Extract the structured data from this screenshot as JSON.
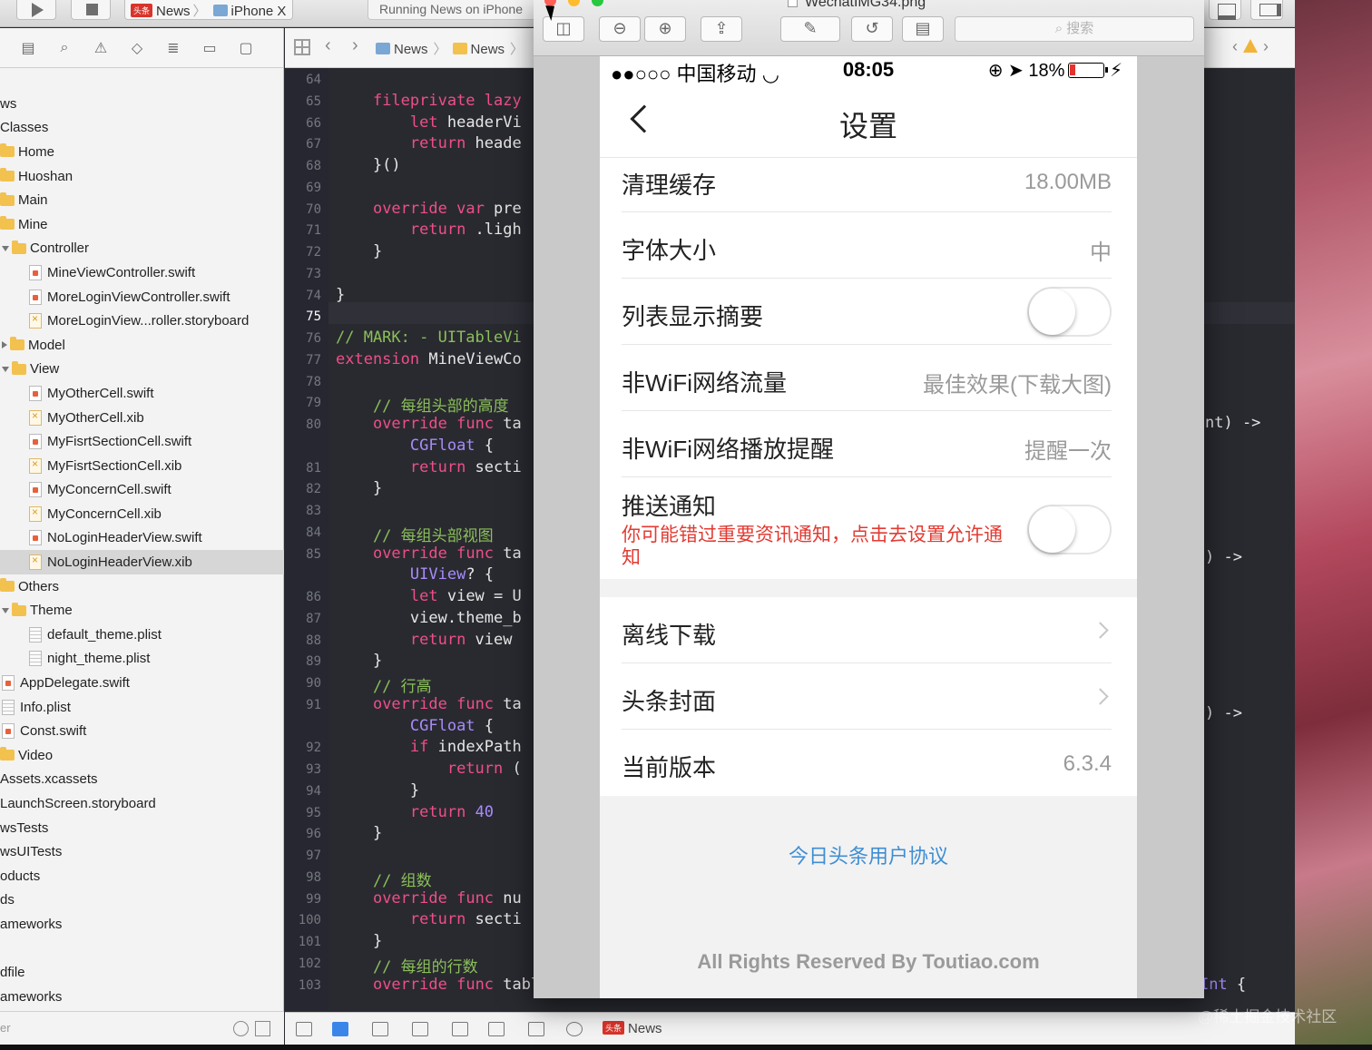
{
  "toolbar": {
    "scheme_badge": "头条",
    "scheme_app": "News",
    "scheme_device": "iPhone X",
    "status_text": "Running News on iPhone"
  },
  "navigator": {
    "files": [
      {
        "label": "ws",
        "kind": "text",
        "indent": 0
      },
      {
        "label": "Classes",
        "kind": "text",
        "indent": 0
      },
      {
        "label": "Home",
        "kind": "folder",
        "indent": 0
      },
      {
        "label": "Huoshan",
        "kind": "folder",
        "indent": 0
      },
      {
        "label": "Main",
        "kind": "folder",
        "indent": 0
      },
      {
        "label": "Mine",
        "kind": "folder",
        "indent": 0
      },
      {
        "label": "Controller",
        "kind": "folder-open",
        "indent": 1
      },
      {
        "label": "MineViewController.swift",
        "kind": "swift",
        "indent": 2
      },
      {
        "label": "MoreLoginViewController.swift",
        "kind": "swift",
        "indent": 2
      },
      {
        "label": "MoreLoginView...roller.storyboard",
        "kind": "xib",
        "indent": 2
      },
      {
        "label": "Model",
        "kind": "folder-closed",
        "indent": 1
      },
      {
        "label": "View",
        "kind": "folder-open",
        "indent": 1
      },
      {
        "label": "MyOtherCell.swift",
        "kind": "swift",
        "indent": 2
      },
      {
        "label": "MyOtherCell.xib",
        "kind": "xib",
        "indent": 2
      },
      {
        "label": "MyFisrtSectionCell.swift",
        "kind": "swift",
        "indent": 2
      },
      {
        "label": "MyFisrtSectionCell.xib",
        "kind": "xib",
        "indent": 2
      },
      {
        "label": "MyConcernCell.swift",
        "kind": "swift",
        "indent": 2
      },
      {
        "label": "MyConcernCell.xib",
        "kind": "xib",
        "indent": 2
      },
      {
        "label": "NoLoginHeaderView.swift",
        "kind": "swift",
        "indent": 2
      },
      {
        "label": "NoLoginHeaderView.xib",
        "kind": "xib",
        "indent": 2,
        "selected": true
      },
      {
        "label": "Others",
        "kind": "folder",
        "indent": 0
      },
      {
        "label": "Theme",
        "kind": "folder-open",
        "indent": 1
      },
      {
        "label": "default_theme.plist",
        "kind": "plist",
        "indent": 2
      },
      {
        "label": "night_theme.plist",
        "kind": "plist",
        "indent": 2
      },
      {
        "label": "AppDelegate.swift",
        "kind": "swift",
        "indent": 1
      },
      {
        "label": "Info.plist",
        "kind": "plist",
        "indent": 1
      },
      {
        "label": "Const.swift",
        "kind": "swift",
        "indent": 1
      },
      {
        "label": "Video",
        "kind": "folder",
        "indent": 0
      },
      {
        "label": "Assets.xcassets",
        "kind": "text",
        "indent": 0
      },
      {
        "label": "LaunchScreen.storyboard",
        "kind": "text",
        "indent": 0
      },
      {
        "label": "wsTests",
        "kind": "text",
        "indent": 0
      },
      {
        "label": "wsUITests",
        "kind": "text",
        "indent": 0
      },
      {
        "label": "oducts",
        "kind": "text",
        "indent": 0
      },
      {
        "label": "ds",
        "kind": "text",
        "indent": 0
      },
      {
        "label": "ameworks",
        "kind": "text",
        "indent": 0
      },
      {
        "label": "",
        "kind": "text",
        "indent": 0
      },
      {
        "label": "dfile",
        "kind": "text",
        "indent": 0
      },
      {
        "label": "ameworks",
        "kind": "text",
        "indent": 0
      }
    ],
    "filter_placeholder": "er"
  },
  "editor": {
    "breadcrumb": [
      "News",
      "News"
    ],
    "lines": [
      {
        "n": "64",
        "code": ""
      },
      {
        "n": "65",
        "code": "    fileprivate lazy"
      },
      {
        "n": "66",
        "code": "        let headerVi"
      },
      {
        "n": "67",
        "code": "        return heade"
      },
      {
        "n": "68",
        "code": "    }()"
      },
      {
        "n": "69",
        "code": ""
      },
      {
        "n": "70",
        "code": "    override var pre"
      },
      {
        "n": "71",
        "code": "        return .ligh"
      },
      {
        "n": "72",
        "code": "    }"
      },
      {
        "n": "73",
        "code": ""
      },
      {
        "n": "74",
        "code": "}"
      },
      {
        "n": "75",
        "code": "",
        "current": true
      },
      {
        "n": "76",
        "code": "// MARK: - UITableVi"
      },
      {
        "n": "77",
        "code": "extension MineViewCo"
      },
      {
        "n": "78",
        "code": ""
      },
      {
        "n": "79",
        "code": "    // 每组头部的高度"
      },
      {
        "n": "80",
        "code": "    override func ta"
      },
      {
        "n": "",
        "code": "        CGFloat {"
      },
      {
        "n": "81",
        "code": "        return secti"
      },
      {
        "n": "82",
        "code": "    }"
      },
      {
        "n": "83",
        "code": ""
      },
      {
        "n": "84",
        "code": "    // 每组头部视图"
      },
      {
        "n": "85",
        "code": "    override func ta"
      },
      {
        "n": "",
        "code": "        UIView? {"
      },
      {
        "n": "86",
        "code": "        let view = U"
      },
      {
        "n": "87",
        "code": "        view.theme_b"
      },
      {
        "n": "88",
        "code": "        return view"
      },
      {
        "n": "89",
        "code": "    }"
      },
      {
        "n": "90",
        "code": "    // 行高"
      },
      {
        "n": "91",
        "code": "    override func ta"
      },
      {
        "n": "",
        "code": "        CGFloat {"
      },
      {
        "n": "92",
        "code": "        if indexPath"
      },
      {
        "n": "93",
        "code": "            return ("
      },
      {
        "n": "94",
        "code": "        }"
      },
      {
        "n": "95",
        "code": "        return 40"
      },
      {
        "n": "96",
        "code": "    }"
      },
      {
        "n": "97",
        "code": ""
      },
      {
        "n": "98",
        "code": "    // 组数"
      },
      {
        "n": "99",
        "code": "    override func nu"
      },
      {
        "n": "100",
        "code": "        return secti"
      },
      {
        "n": "101",
        "code": "    }"
      },
      {
        "n": "102",
        "code": "    // 每组的行数"
      },
      {
        "n": "103",
        "code": "    override func tableView(_ tableView: UITableView, numberOfRowsInSection section: Int) -> Int {"
      }
    ],
    "right_fragments": [
      "nt) ->",
      ") ->",
      ") ->"
    ]
  },
  "debug": {
    "scheme_badge": "头条",
    "scheme_label": "News"
  },
  "watermark": "@稀土掘金技术社区",
  "preview": {
    "title": "WechatIMG34.png",
    "search_placeholder": "搜索"
  },
  "phone": {
    "status": {
      "carrier": "●●○○○ 中国移动",
      "time": "08:05",
      "battery": "18%"
    },
    "nav_title": "设置",
    "rows": [
      {
        "label": "清理缓存",
        "value": "18.00MB"
      },
      {
        "label": "字体大小",
        "value": "中"
      },
      {
        "label": "列表显示摘要",
        "toggle": false
      },
      {
        "label": "非WiFi网络流量",
        "value": "最佳效果(下载大图)"
      },
      {
        "label": "非WiFi网络播放提醒",
        "value": "提醒一次"
      },
      {
        "label": "推送通知",
        "sub": "你可能错过重要资讯通知，点击去设置允许通知",
        "toggle": false
      },
      {
        "label": "离线下载",
        "chevron": true
      },
      {
        "label": "头条封面",
        "chevron": true
      },
      {
        "label": "当前版本",
        "value": "6.3.4"
      }
    ],
    "agreement_link": "今日头条用户协议",
    "footer": "All Rights Reserved By Toutiao.com"
  }
}
